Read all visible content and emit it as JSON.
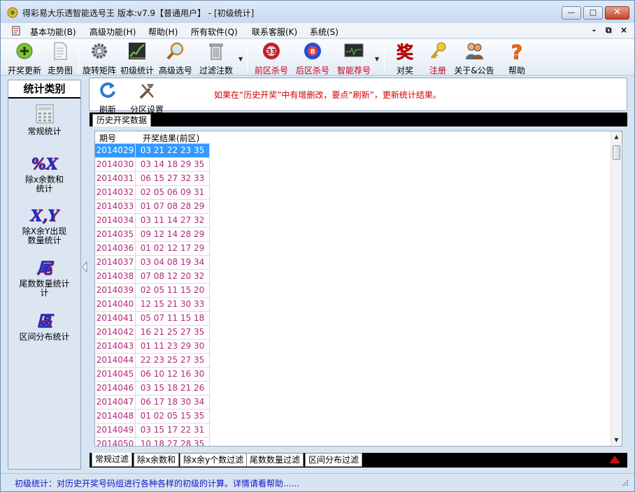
{
  "window": {
    "title": "得彩易大乐透智能选号王 版本:v7.9【普通用户】 - [初级统计]",
    "controls": {
      "minimize": "—",
      "maximize": "□",
      "close": "✕"
    }
  },
  "menubar": {
    "items": [
      "基本功能(B)",
      "高级功能(H)",
      "帮助(H)",
      "所有软件(Q)",
      "联系客服(K)",
      "系统(S)"
    ],
    "mdi_controls": [
      "-",
      "⧉",
      "×"
    ]
  },
  "toolbar": {
    "buttons": [
      {
        "label": "开奖更新",
        "icon": "green-plus-icon"
      },
      {
        "label": "走势图",
        "icon": "document-icon"
      },
      {
        "label": "旋转矩阵",
        "icon": "gear-icon"
      },
      {
        "label": "初级统计",
        "icon": "trend-chart-icon"
      },
      {
        "label": "高级选号",
        "icon": "magnifier-icon"
      },
      {
        "label": "过滤注数",
        "icon": "trash-can-icon"
      },
      {
        "label": "前区杀号",
        "icon": "red-ball-icon",
        "ball": "33"
      },
      {
        "label": "后区杀号",
        "icon": "blue-ball-icon",
        "ball": "8"
      },
      {
        "label": "智能荐号",
        "icon": "monitor-icon"
      },
      {
        "label": "对奖",
        "icon": "prize-icon",
        "glyph": "奖"
      },
      {
        "label": "注册",
        "icon": "key-icon"
      },
      {
        "label": "关于&公告",
        "icon": "people-icon"
      },
      {
        "label": "帮助",
        "icon": "question-icon"
      }
    ]
  },
  "leftpanel": {
    "heading": "统计类别",
    "items": [
      {
        "label": "常规统计",
        "icon": "calculator-icon"
      },
      {
        "label": "除x余数和统计",
        "icon": "percent-x-icon",
        "glyph": "%X"
      },
      {
        "label": "除X余Y出现数量统计",
        "icon": "xy-icon",
        "glyph": "X,Y"
      },
      {
        "label": "尾数数量统计计",
        "icon": "tail-icon",
        "glyph": "尾"
      },
      {
        "label": "区间分布统计",
        "icon": "zone-icon",
        "glyph": "區"
      }
    ]
  },
  "main": {
    "refresh_label": "刷新",
    "zone_settings_label": "分区设置",
    "notice": "如果在“历史开奖”中有增删改，要点“刷新”，更新统计结果。",
    "history_tab": "历史开奖数据",
    "columns": [
      "期号",
      "开奖结果(前区)"
    ],
    "rows": [
      [
        "2014029",
        "03 21 22 23 35"
      ],
      [
        "2014030",
        "03 14 18 29 35"
      ],
      [
        "2014031",
        "06 15 27 32 33"
      ],
      [
        "2014032",
        "02 05 06 09 31"
      ],
      [
        "2014033",
        "01 07 08 28 29"
      ],
      [
        "2014034",
        "03 11 14 27 32"
      ],
      [
        "2014035",
        "09 12 14 28 29"
      ],
      [
        "2014036",
        "01 02 12 17 29"
      ],
      [
        "2014037",
        "03 04 08 19 34"
      ],
      [
        "2014038",
        "07 08 12 20 32"
      ],
      [
        "2014039",
        "02 05 11 15 20"
      ],
      [
        "2014040",
        "12 15 21 30 33"
      ],
      [
        "2014041",
        "05 07 11 15 18"
      ],
      [
        "2014042",
        "16 21 25 27 35"
      ],
      [
        "2014043",
        "01 11 23 29 30"
      ],
      [
        "2014044",
        "22 23 25 27 35"
      ],
      [
        "2014045",
        "06 10 12 16 30"
      ],
      [
        "2014046",
        "03 15 18 21 26"
      ],
      [
        "2014047",
        "06 17 18 30 34"
      ],
      [
        "2014048",
        "01 02 05 15 35"
      ],
      [
        "2014049",
        "03 15 17 22 31"
      ],
      [
        "2014050",
        "10 18 27 28 35"
      ]
    ],
    "selected_row": 0,
    "bottom_tabs": [
      "常规过滤",
      "除x余数和",
      "除x余y个数过滤",
      "尾数数量过滤",
      "区间分布过滤"
    ]
  },
  "status": {
    "text": "初级统计：对历史开奖号码组进行各种各样的初级的计算。详情请看帮助......"
  },
  "colors": {
    "accent_red": "#c0001a",
    "selection": "#3399ff",
    "data_text": "#b0297a",
    "status_text": "#1515c8"
  }
}
